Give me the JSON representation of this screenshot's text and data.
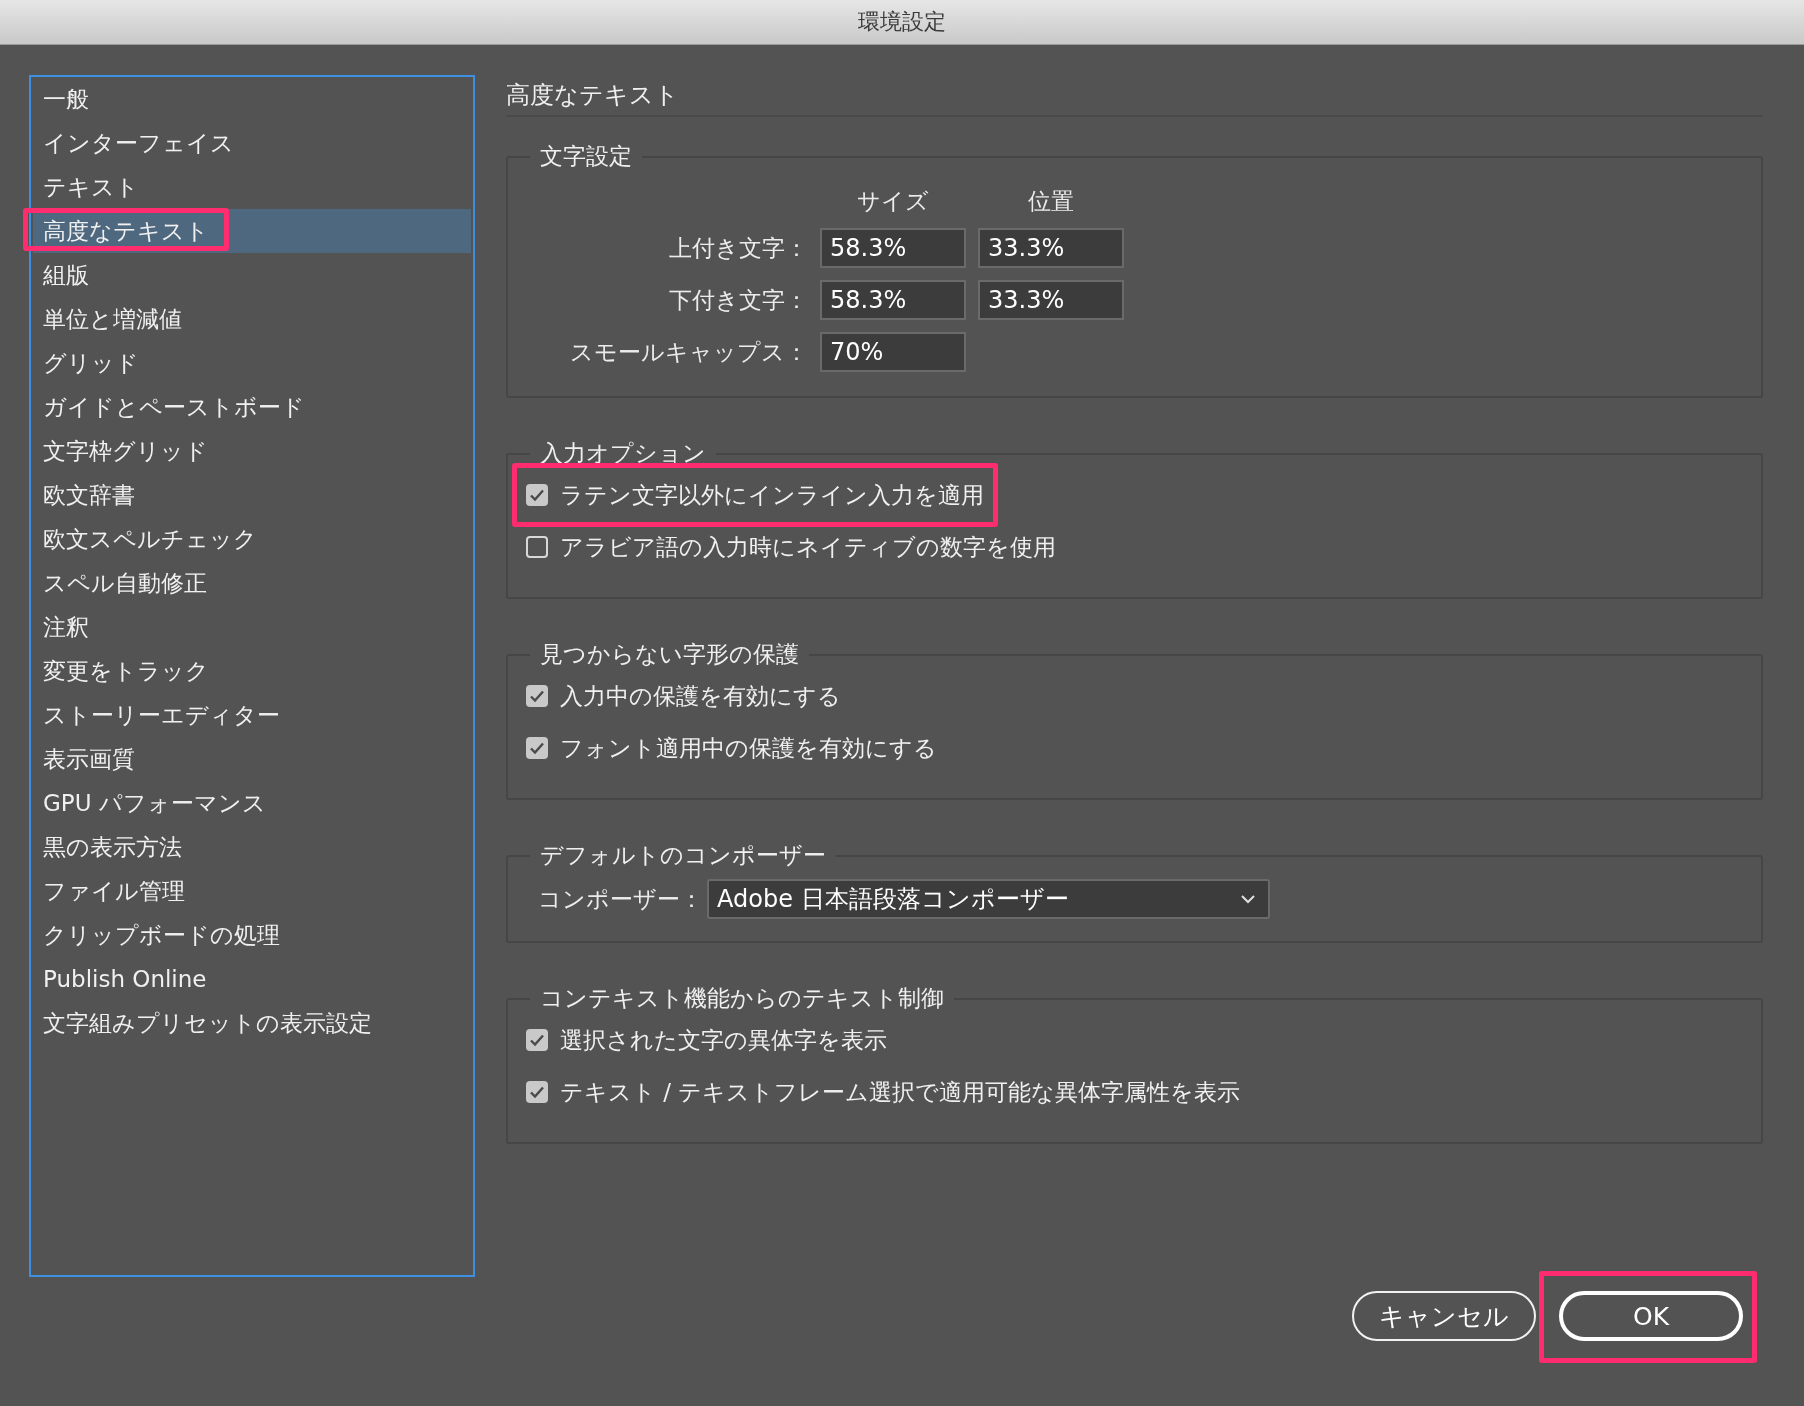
{
  "window": {
    "title": "環境設定"
  },
  "sidebar": {
    "items": [
      {
        "label": "一般",
        "selected": false,
        "highlighted": false
      },
      {
        "label": "インターフェイス",
        "selected": false,
        "highlighted": false
      },
      {
        "label": "テキスト",
        "selected": false,
        "highlighted": false
      },
      {
        "label": "高度なテキスト",
        "selected": true,
        "highlighted": true
      },
      {
        "label": "組版",
        "selected": false,
        "highlighted": false
      },
      {
        "label": "単位と増減値",
        "selected": false,
        "highlighted": false
      },
      {
        "label": "グリッド",
        "selected": false,
        "highlighted": false
      },
      {
        "label": "ガイドとペーストボード",
        "selected": false,
        "highlighted": false
      },
      {
        "label": "文字枠グリッド",
        "selected": false,
        "highlighted": false
      },
      {
        "label": "欧文辞書",
        "selected": false,
        "highlighted": false
      },
      {
        "label": "欧文スペルチェック",
        "selected": false,
        "highlighted": false
      },
      {
        "label": "スペル自動修正",
        "selected": false,
        "highlighted": false
      },
      {
        "label": "注釈",
        "selected": false,
        "highlighted": false
      },
      {
        "label": "変更をトラック",
        "selected": false,
        "highlighted": false
      },
      {
        "label": "ストーリーエディター",
        "selected": false,
        "highlighted": false
      },
      {
        "label": "表示画質",
        "selected": false,
        "highlighted": false
      },
      {
        "label": "GPU パフォーマンス",
        "selected": false,
        "highlighted": false
      },
      {
        "label": "黒の表示方法",
        "selected": false,
        "highlighted": false
      },
      {
        "label": "ファイル管理",
        "selected": false,
        "highlighted": false
      },
      {
        "label": "クリップボードの処理",
        "selected": false,
        "highlighted": false
      },
      {
        "label": "Publish Online",
        "selected": false,
        "highlighted": false
      },
      {
        "label": "文字組みプリセットの表示設定",
        "selected": false,
        "highlighted": false
      }
    ]
  },
  "panel": {
    "title": "高度なテキスト",
    "groups": [
      {
        "kind": "char-settings",
        "legend": "文字設定",
        "columns": [
          "サイズ",
          "位置"
        ],
        "rows": [
          {
            "label": "上付き文字：",
            "values": [
              "58.3%",
              "33.3%"
            ]
          },
          {
            "label": "下付き文字：",
            "values": [
              "58.3%",
              "33.3%"
            ]
          },
          {
            "label": "スモールキャップス：",
            "values": [
              "70%"
            ]
          }
        ]
      },
      {
        "kind": "checkboxes",
        "legend": "入力オプション",
        "items": [
          {
            "label": "ラテン文字以外にインライン入力を適用",
            "checked": true,
            "highlighted": true
          },
          {
            "label": "アラビア語の入力時にネイティブの数字を使用",
            "checked": false,
            "highlighted": false
          }
        ]
      },
      {
        "kind": "checkboxes",
        "legend": "見つからない字形の保護",
        "items": [
          {
            "label": "入力中の保護を有効にする",
            "checked": true,
            "highlighted": false
          },
          {
            "label": "フォント適用中の保護を有効にする",
            "checked": true,
            "highlighted": false
          }
        ]
      },
      {
        "kind": "composer",
        "legend": "デフォルトのコンポーザー",
        "label": "コンポーザー：",
        "value": "Adobe 日本語段落コンポーザー"
      },
      {
        "kind": "checkboxes",
        "legend": "コンテキスト機能からのテキスト制御",
        "items": [
          {
            "label": "選択された文字の異体字を表示",
            "checked": true,
            "highlighted": false
          },
          {
            "label": "テキスト / テキストフレーム選択で適用可能な異体字属性を表示",
            "checked": true,
            "highlighted": false
          }
        ]
      }
    ]
  },
  "buttons": [
    {
      "label": "キャンセル",
      "default": false,
      "highlighted": false
    },
    {
      "label": "OK",
      "default": true,
      "highlighted": true
    }
  ]
}
